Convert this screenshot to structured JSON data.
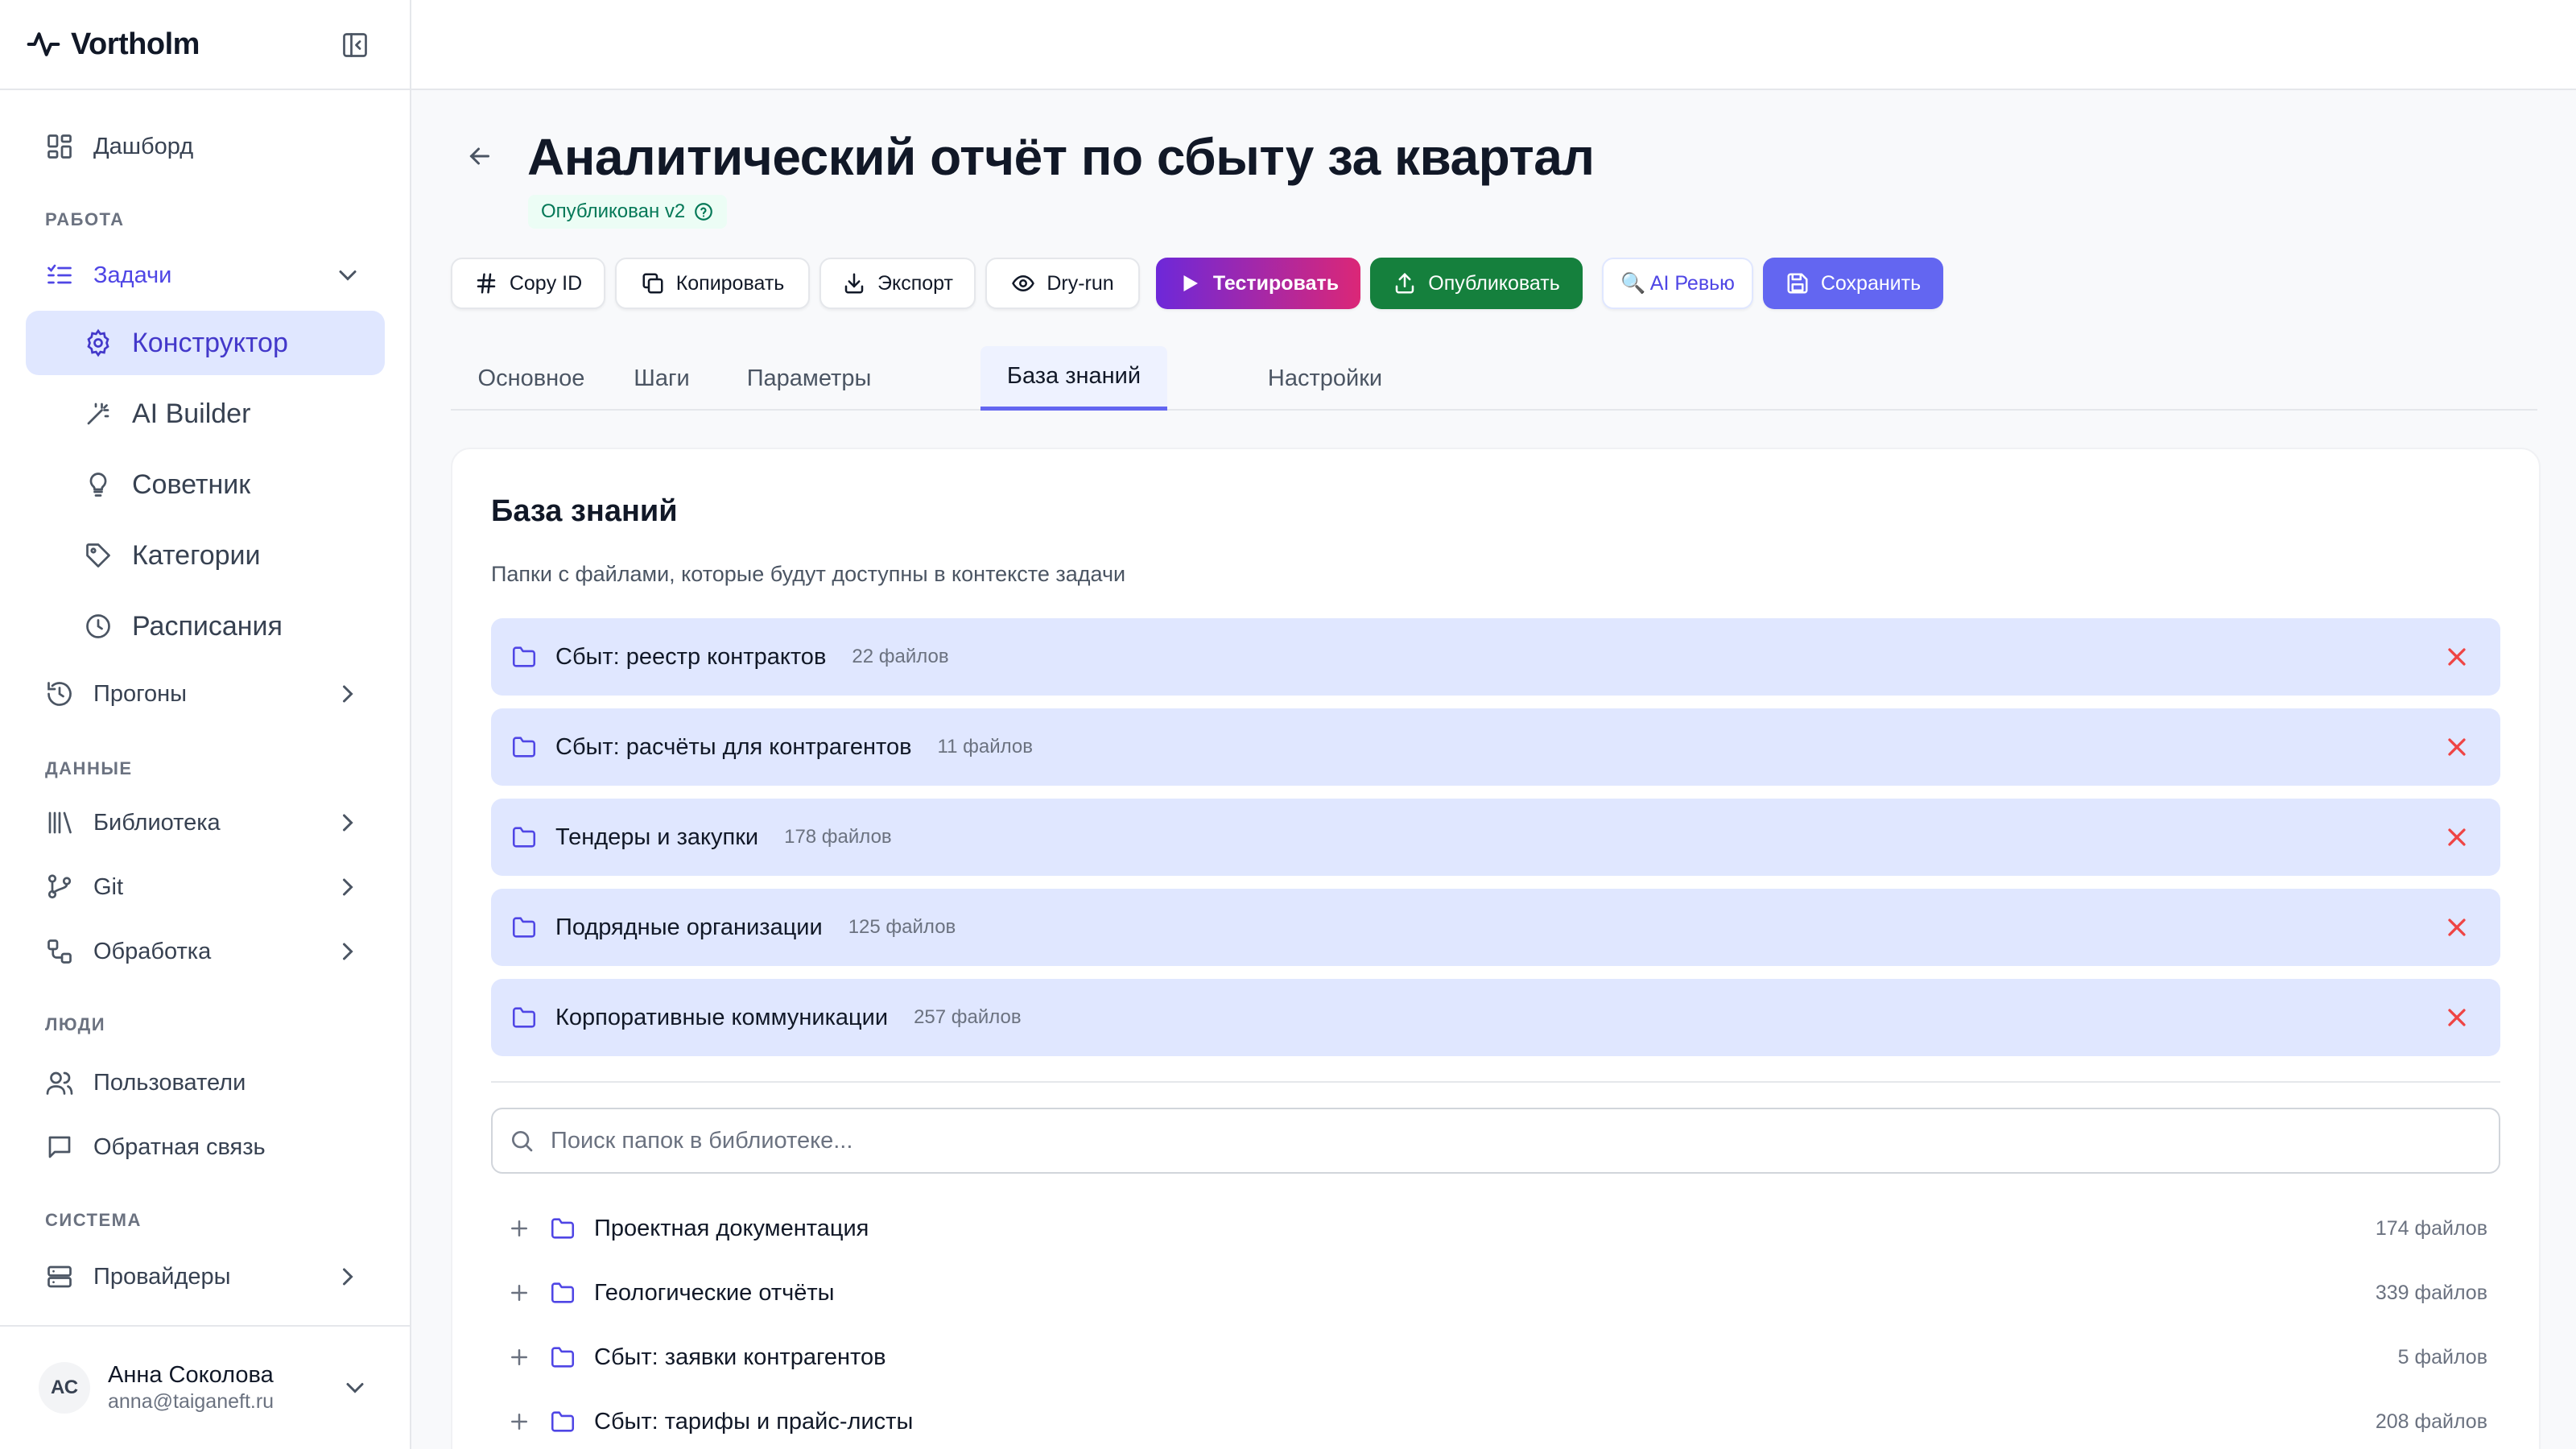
{
  "app": {
    "name": "Vortholm"
  },
  "sidebar": {
    "items": {
      "dashboard": "Дашборд",
      "tasks": "Задачи",
      "constructor": "Конструктор",
      "ai_builder": "AI Builder",
      "advisor": "Советник",
      "categories": "Категории",
      "schedules": "Расписания",
      "runs": "Прогоны",
      "library": "Библиотека",
      "git": "Git",
      "processing": "Обработка",
      "users": "Пользователи",
      "feedback": "Обратная связь",
      "providers": "Провайдеры"
    },
    "sections": {
      "work": "РАБОТА",
      "data": "ДАННЫЕ",
      "people": "ЛЮДИ",
      "system": "СИСТЕМА"
    },
    "user": {
      "initials": "АС",
      "name": "Анна Соколова",
      "email": "anna@taiganeft.ru"
    }
  },
  "header": {
    "title": "Аналитический отчёт по сбыту за квартал",
    "status": "Опубликован v2"
  },
  "toolbar": {
    "copy_id": "Copy ID",
    "copy": "Копировать",
    "export": "Экспорт",
    "dry_run": "Dry-run",
    "test": "Тестировать",
    "publish": "Опубликовать",
    "ai_review": "🔍 AI Ревью",
    "save": "Сохранить"
  },
  "tabs": [
    "Основное",
    "Шаги",
    "Параметры",
    "База знаний",
    "Настройки"
  ],
  "active_tab": "База знаний",
  "knowledge": {
    "title": "База знаний",
    "description": "Папки с файлами, которые будут доступны в контексте задачи",
    "attached": [
      {
        "name": "Сбыт: реестр контрактов",
        "count": "22 файлов"
      },
      {
        "name": "Сбыт: расчёты для контрагентов",
        "count": "11 файлов"
      },
      {
        "name": "Тендеры и закупки",
        "count": "178 файлов"
      },
      {
        "name": "Подрядные организации",
        "count": "125 файлов"
      },
      {
        "name": "Корпоративные коммуникации",
        "count": "257 файлов"
      }
    ],
    "search_placeholder": "Поиск папок в библиотеке...",
    "library": [
      {
        "name": "Проектная документация",
        "count": "174 файлов"
      },
      {
        "name": "Геологические отчёты",
        "count": "339 файлов"
      },
      {
        "name": "Сбыт: заявки контрагентов",
        "count": "5 файлов"
      },
      {
        "name": "Сбыт: тарифы и прайс-листы",
        "count": "208 файлов"
      }
    ]
  },
  "colors": {
    "accent": "#6366f1",
    "active_bg": "#e0e7ff",
    "publish": "#15803d",
    "remove": "#ef4444",
    "status": "#047857"
  }
}
